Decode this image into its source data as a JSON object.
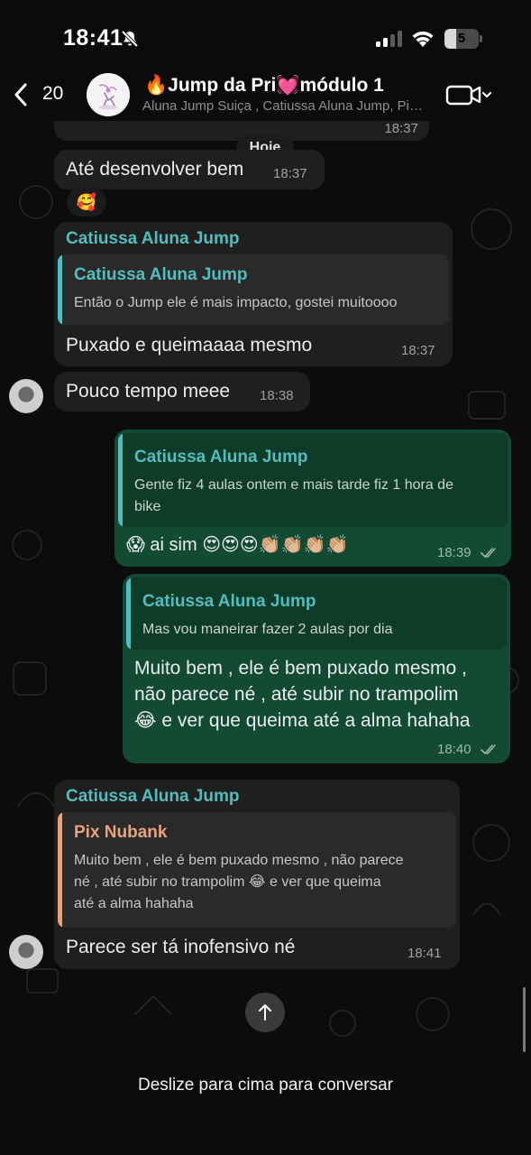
{
  "status_bar": {
    "time": "18:41",
    "battery_level": "5",
    "battery_fraction": 0.35
  },
  "header": {
    "back_count": "20",
    "title": "🔥Jump da Pri💓módulo 1",
    "subtitle": "Aluna Jump Suiça , Catiussa Aluna Jump, Pix Nubank",
    "icons": [
      "chevron-left-icon",
      "video-camera-icon",
      "chevron-down-icon"
    ]
  },
  "chat": {
    "date_label": "Hoje",
    "messages": [
      {
        "id": "m0",
        "direction": "in",
        "time": "18:37"
      },
      {
        "id": "m1",
        "direction": "in",
        "text": "Até desenvolver bem",
        "time": "18:37",
        "reaction": "🥰"
      },
      {
        "id": "m2",
        "direction": "in",
        "sender": "Catiussa Aluna Jump",
        "quote": {
          "name": "Catiussa Aluna Jump",
          "text": "Então o Jump ele é mais impacto, gostei muitoooo",
          "color": "#53bdbd"
        },
        "text": "Puxado e queimaaaa mesmo",
        "time": "18:37"
      },
      {
        "id": "m3",
        "direction": "in",
        "text": "Pouco tempo meee",
        "time": "18:38"
      },
      {
        "id": "m4",
        "direction": "out",
        "quote": {
          "name": "Catiussa Aluna Jump",
          "line1": "Gente fiz 4 aulas ontem e mais tarde fiz 1 hora de",
          "line2": "bike",
          "color": "#53bdbd"
        },
        "text": "😱 ai sim 😍😍😍👏🏼👏🏼👏🏼👏🏼",
        "time": "18:39"
      },
      {
        "id": "m5",
        "direction": "out",
        "quote": {
          "name": "Catiussa Aluna Jump",
          "text": "Mas vou maneirar fazer 2 aulas por dia",
          "color": "#53bdbd"
        },
        "line1": "Muito bem , ele é bem puxado mesmo ,",
        "line2": "não parece né , até subir no trampolim",
        "line3": "😂 e ver que queima até a alma hahaha",
        "time": "18:40"
      },
      {
        "id": "m6",
        "direction": "in",
        "sender": "Catiussa Aluna Jump",
        "quote": {
          "name": "Pix Nubank",
          "line1": "Muito bem , ele é bem puxado mesmo , não parece",
          "line2": "né , até subir no trampolim 😂 e ver que queima",
          "line3": "até a alma hahaha",
          "color": "#e8a27c"
        },
        "text": "Parece ser tá inofensivo né",
        "time": "18:41"
      }
    ]
  },
  "bottom": {
    "hint": "Deslize para cima para conversar"
  },
  "colors": {
    "incoming_bubble": "#1f1f1f",
    "outgoing_bubble": "#124a33",
    "sender_name": "#53bdbd",
    "pix_name": "#e8a27c",
    "read_ticks": "#9fb8ab"
  }
}
